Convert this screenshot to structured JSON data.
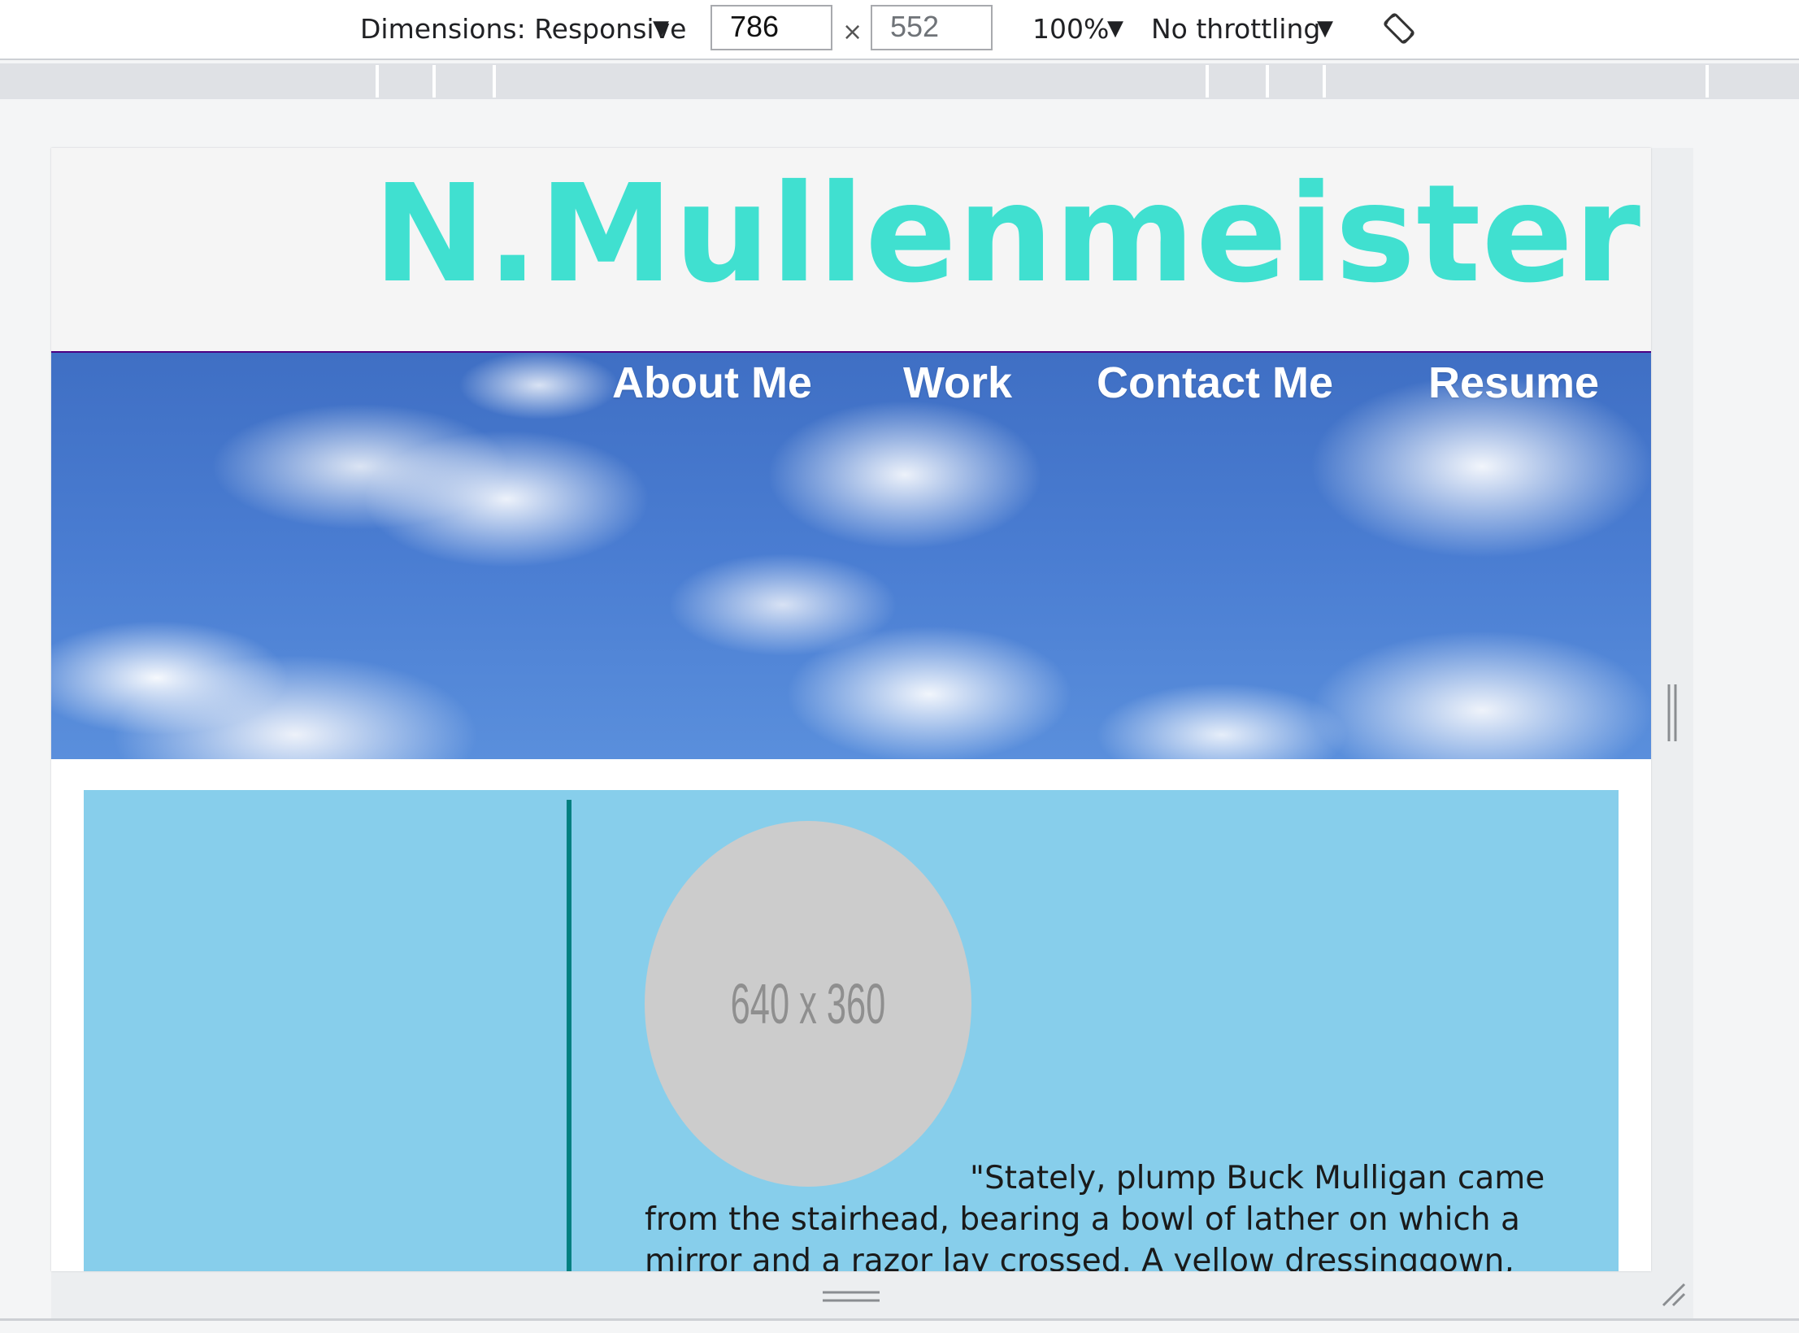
{
  "toolbar": {
    "dimensions_label": "Dimensions: Responsive",
    "width_value": "786",
    "height_value": "552",
    "times_symbol": "×",
    "zoom_label": "100%",
    "throttling_label": "No throttling"
  },
  "icons": {
    "dimensions_dropdown": "chevron-down-icon",
    "zoom_dropdown": "chevron-down-icon",
    "throttling_dropdown": "chevron-down-icon",
    "rotate": "rotate-icon",
    "resize_right": "resize-handle-icon",
    "resize_bottom": "resize-handle-icon",
    "resize_corner": "resize-corner-icon"
  },
  "site": {
    "title": "N.Mullenmeister",
    "nav": [
      "About Me",
      "Work",
      "Contact Me",
      "Resume"
    ],
    "profile_placeholder": "640 x 360",
    "bio": "\"Stately, plump Buck Mulligan came from the stairhead, bearing a bowl of lather on which a mirror and a razor lay crossed. A yellow dressinggown,"
  },
  "colors": {
    "title": "#40e0d0",
    "panel": "#87ceeb",
    "divider": "#008080",
    "placeholder": "#cccccc",
    "nav_text": "#ffffff"
  }
}
